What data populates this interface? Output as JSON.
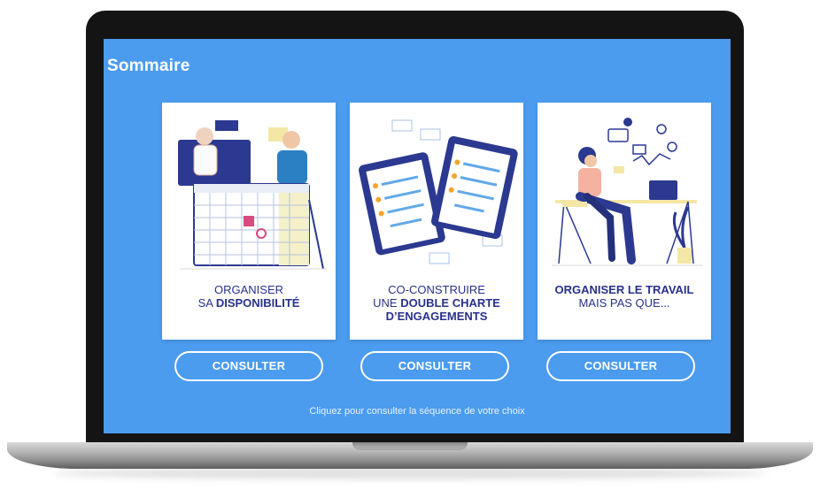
{
  "page": {
    "title": "Sommaire"
  },
  "cards": [
    {
      "line1": "ORGANISER",
      "line2_prefix": "SA ",
      "line2_bold": "DISPONIBILITÉ",
      "button": "CONSULTER"
    },
    {
      "line1": "CO-CONSTRUIRE",
      "line2_prefix": "UNE ",
      "line2_bold": "DOUBLE CHARTE",
      "line3_bold": "D’ENGAGEMENTS",
      "button": "CONSULTER"
    },
    {
      "line1_bold": "ORGANISER LE TRAVAIL",
      "line2": "MAIS PAS QUE...",
      "button": "CONSULTER"
    }
  ],
  "footer": {
    "hint": "Cliquez pour consulter la séquence de votre choix"
  },
  "colors": {
    "screen": "#4b9bee",
    "text_dark": "#28318a",
    "button_border": "#ffffff"
  }
}
